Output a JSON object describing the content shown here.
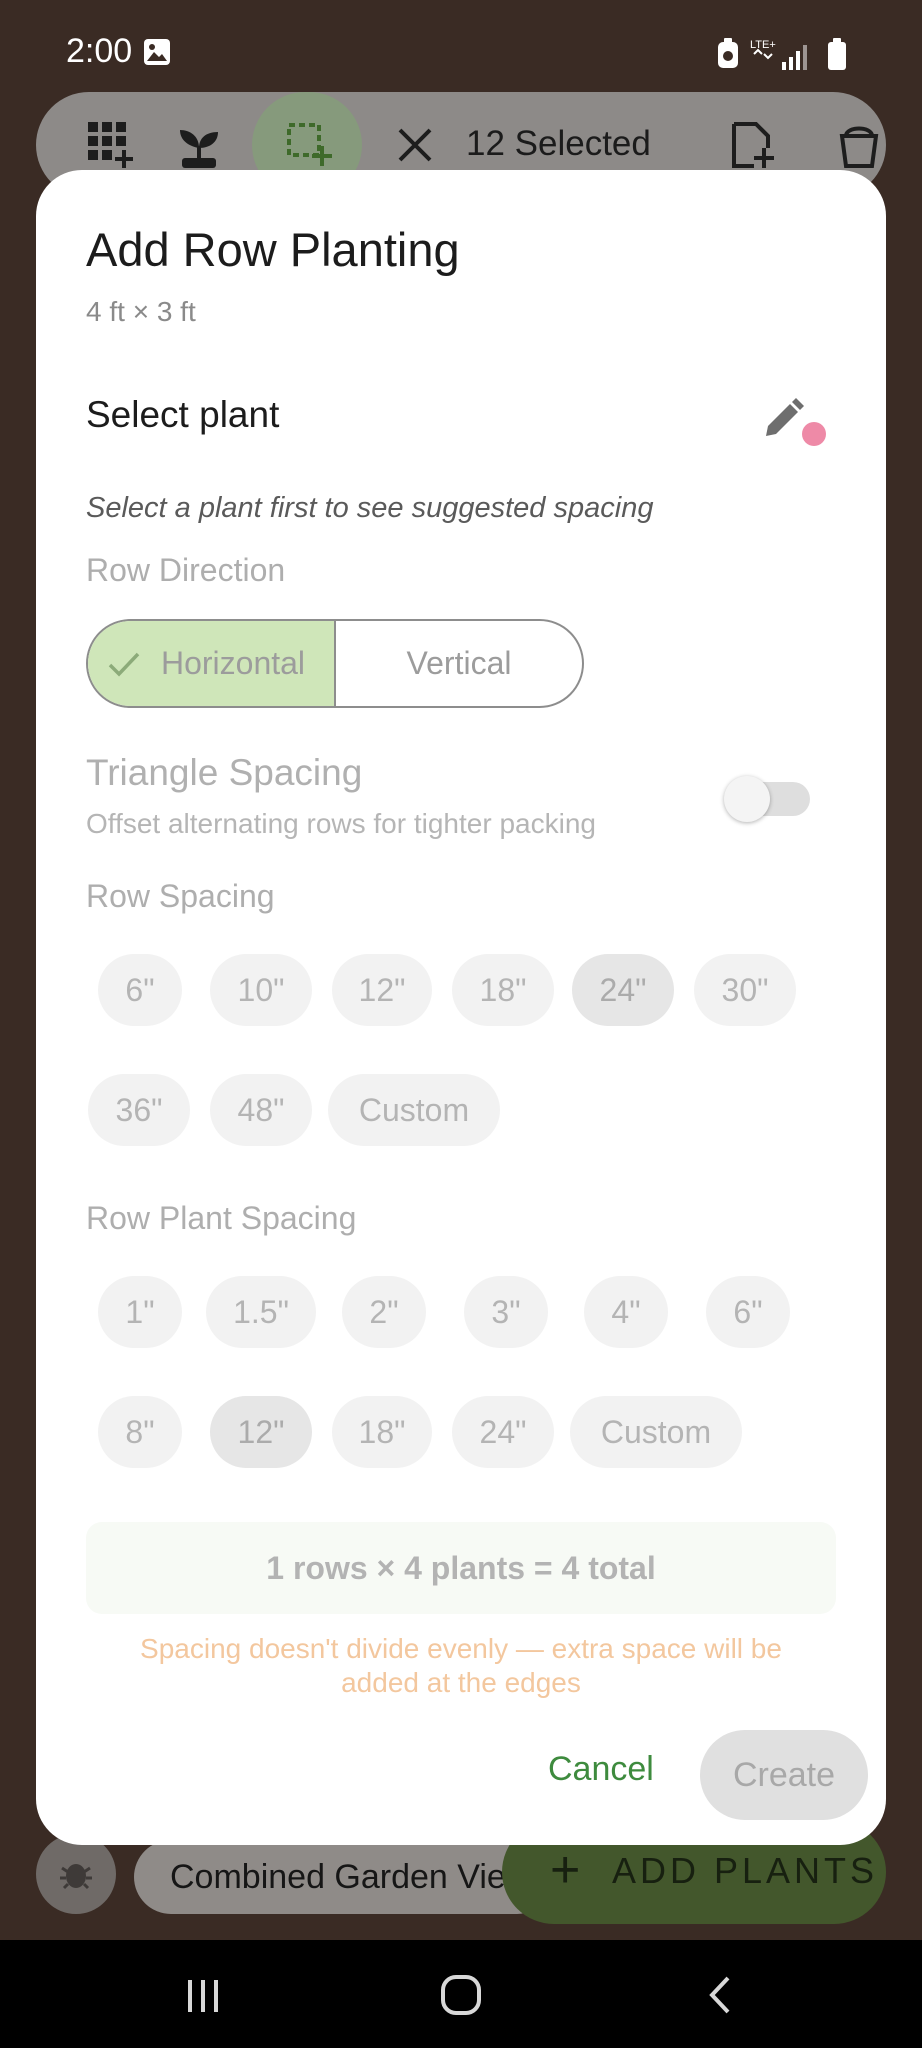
{
  "status_bar": {
    "time": "2:00",
    "network": "LTE+"
  },
  "toolbar": {
    "selected_count": "12 Selected"
  },
  "background": {
    "garden_name": "Combined Garden Vie",
    "add_plants_label": "ADD PLANTS"
  },
  "dialog": {
    "title": "Add Row Planting",
    "size": "4 ft × 3 ft",
    "select_plant_label": "Select plant",
    "hint": "Select a plant first to see suggested spacing",
    "row_direction": {
      "label": "Row Direction",
      "options": [
        "Horizontal",
        "Vertical"
      ],
      "selected": "Horizontal"
    },
    "triangle_spacing": {
      "title": "Triangle Spacing",
      "subtitle": "Offset alternating rows for tighter packing",
      "enabled": false
    },
    "row_spacing": {
      "label": "Row Spacing",
      "options": [
        "6\"",
        "10\"",
        "12\"",
        "18\"",
        "24\"",
        "30\"",
        "36\"",
        "48\"",
        "Custom"
      ],
      "selected": "24\""
    },
    "row_plant_spacing": {
      "label": "Row Plant Spacing",
      "options": [
        "1\"",
        "1.5\"",
        "2\"",
        "3\"",
        "4\"",
        "6\"",
        "8\"",
        "12\"",
        "18\"",
        "24\"",
        "Custom"
      ],
      "selected": "12\""
    },
    "summary": "1 rows × 4 plants = 4 total",
    "warning": "Spacing doesn't divide evenly — extra space will be added at the edges",
    "cancel_label": "Cancel",
    "create_label": "Create"
  },
  "colors": {
    "backdrop": "#3a2b24",
    "accent_green": "#3e8b3e",
    "selected_segment": "#cfe6b9",
    "warning": "#f3c79e",
    "indicator_dot": "#ee8aa7"
  }
}
